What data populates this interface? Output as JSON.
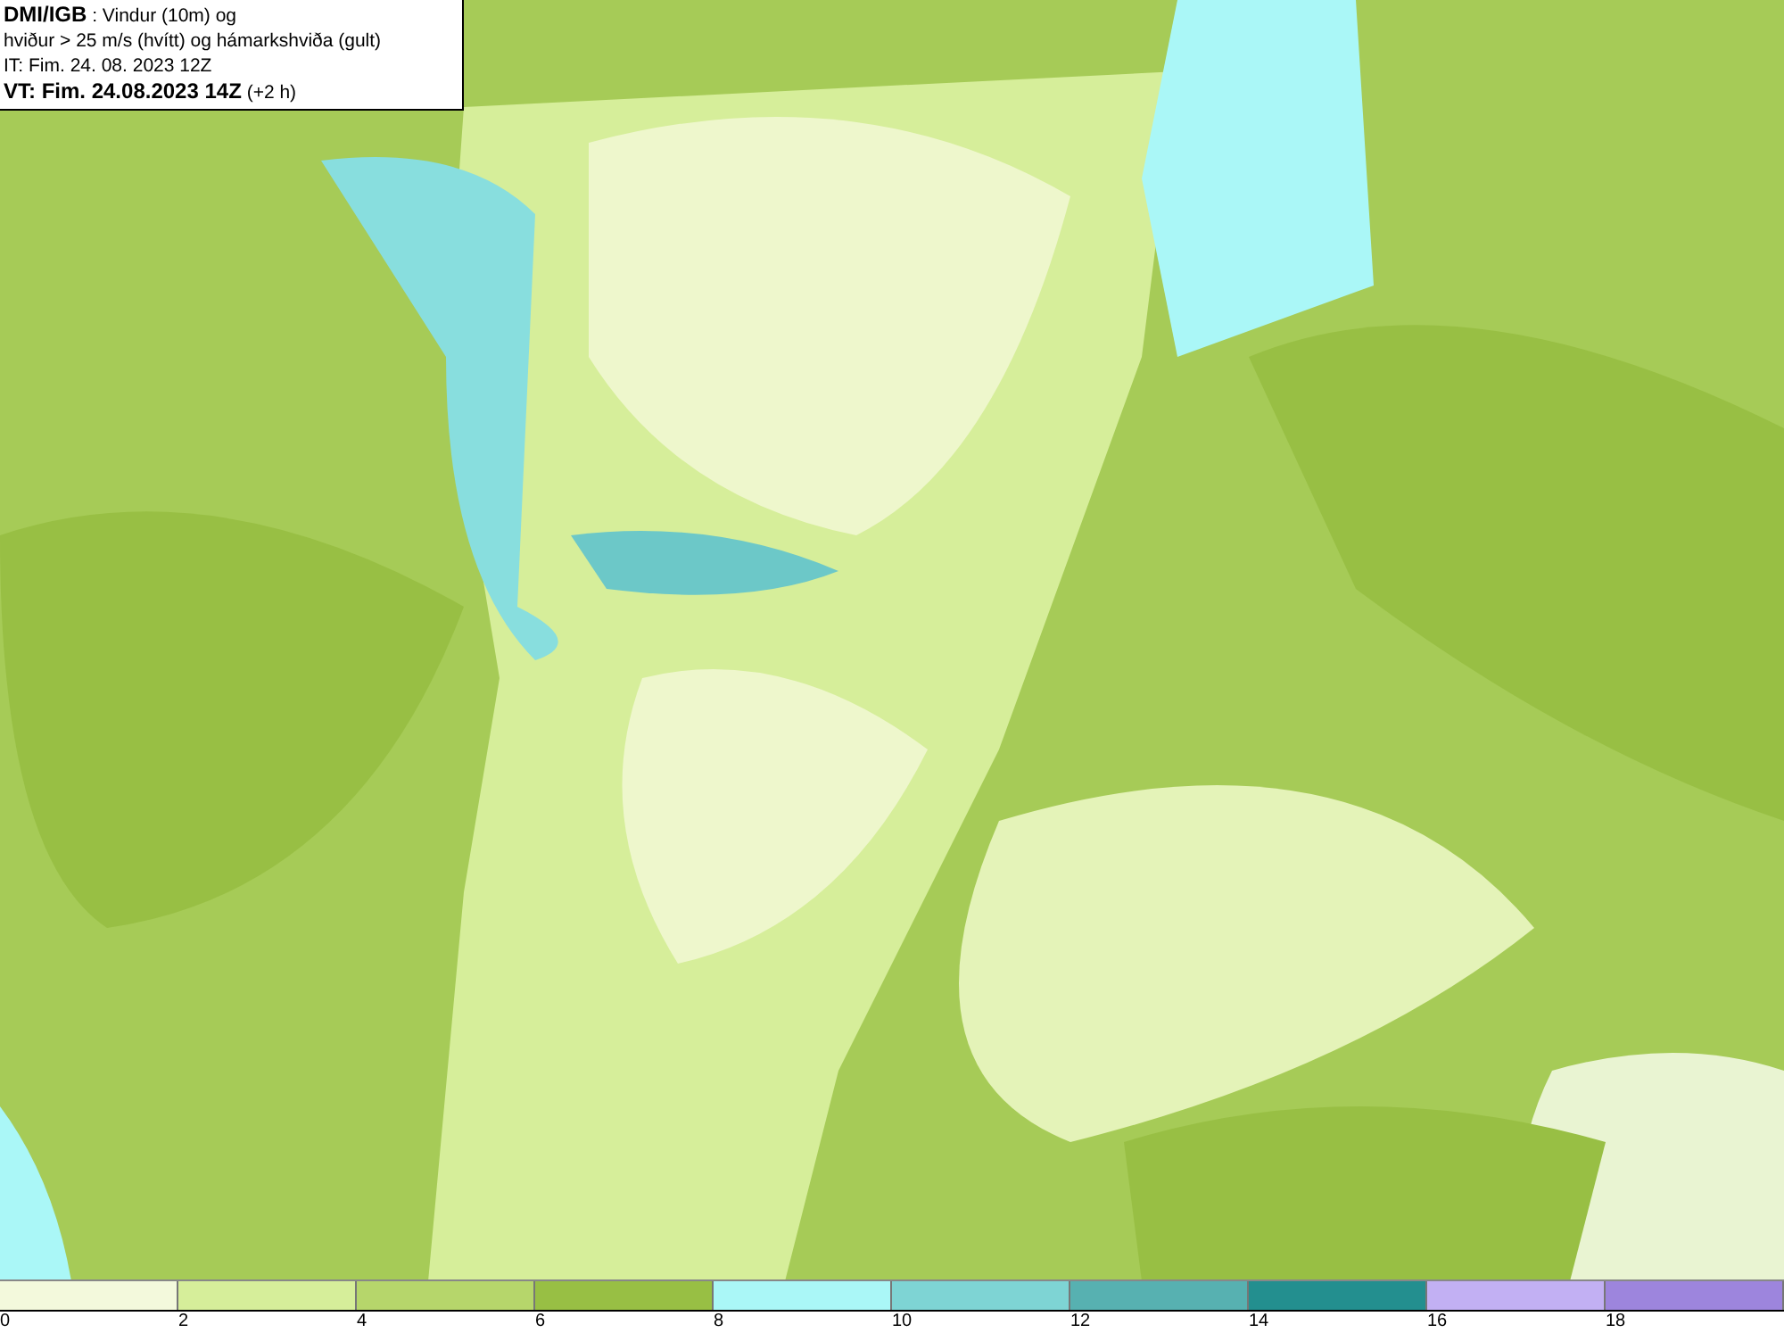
{
  "title_box": {
    "lines": [
      "**DMI/IGB** : Vindur (10m) og",
      "hviður > 25 m/s (hvítt) og hámarkshviða (gult)",
      "IT: Fim. 24. 08. 2023 12Z",
      "**VT: Fim. 24.08.2023 14Z** (+2 h)"
    ]
  },
  "legend": {
    "bins": [
      {
        "label": "0",
        "color": "#f3f9dc"
      },
      {
        "label": "2",
        "color": "#d6ee9a"
      },
      {
        "label": "4",
        "color": "#b6d66b"
      },
      {
        "label": "6",
        "color": "#98bf44"
      },
      {
        "label": "8",
        "color": "#aaf7f7"
      },
      {
        "label": "10",
        "color": "#7ed4d4"
      },
      {
        "label": "12",
        "color": "#57b1b1"
      },
      {
        "label": "14",
        "color": "#238f8f"
      },
      {
        "label": "16",
        "color": "#c2b0f3"
      },
      {
        "label": "18",
        "color": "#9d85dd"
      }
    ]
  }
}
